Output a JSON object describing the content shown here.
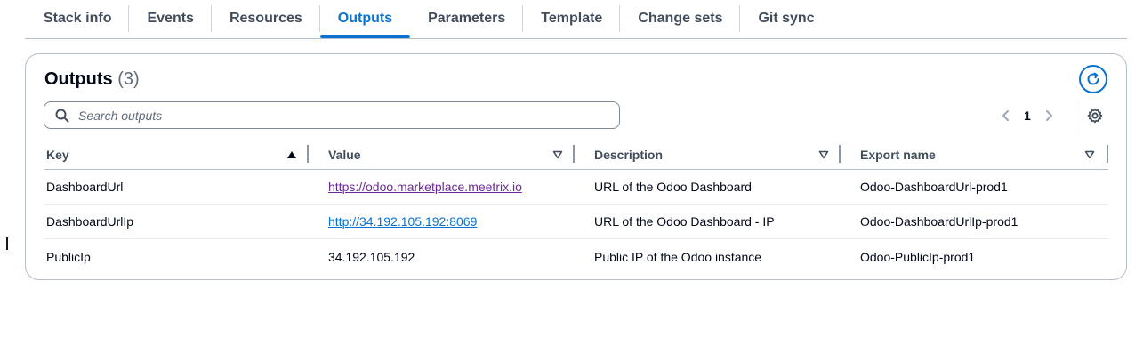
{
  "tabs": [
    {
      "label": "Stack info",
      "active": false
    },
    {
      "label": "Events",
      "active": false
    },
    {
      "label": "Resources",
      "active": false
    },
    {
      "label": "Outputs",
      "active": true
    },
    {
      "label": "Parameters",
      "active": false
    },
    {
      "label": "Template",
      "active": false
    },
    {
      "label": "Change sets",
      "active": false
    },
    {
      "label": "Git sync",
      "active": false
    }
  ],
  "panel": {
    "title": "Outputs",
    "count": "(3)",
    "refresh_icon": "refresh-icon",
    "settings_icon": "gear-icon"
  },
  "search": {
    "placeholder": "Search outputs",
    "value": ""
  },
  "pagination": {
    "current_page": "1"
  },
  "table": {
    "columns": [
      "Key",
      "Value",
      "Description",
      "Export name"
    ],
    "rows": [
      {
        "key": "DashboardUrl",
        "value": "https://odoo.marketplace.meetrix.io",
        "description": "URL of the Odoo Dashboard",
        "export_name": "Odoo-DashboardUrl-prod1"
      },
      {
        "key": "DashboardUrlIp",
        "value": "http://34.192.105.192:8069",
        "description": "URL of the Odoo Dashboard - IP",
        "export_name": "Odoo-DashboardUrlIp-prod1"
      },
      {
        "key": "PublicIp",
        "value": "34.192.105.192",
        "description": "Public IP of the Odoo instance",
        "export_name": "Odoo-PublicIp-prod1"
      }
    ]
  },
  "colors": {
    "accent": "#0972d3",
    "visited_link": "#6b2a96",
    "border": "#b6bec9"
  }
}
